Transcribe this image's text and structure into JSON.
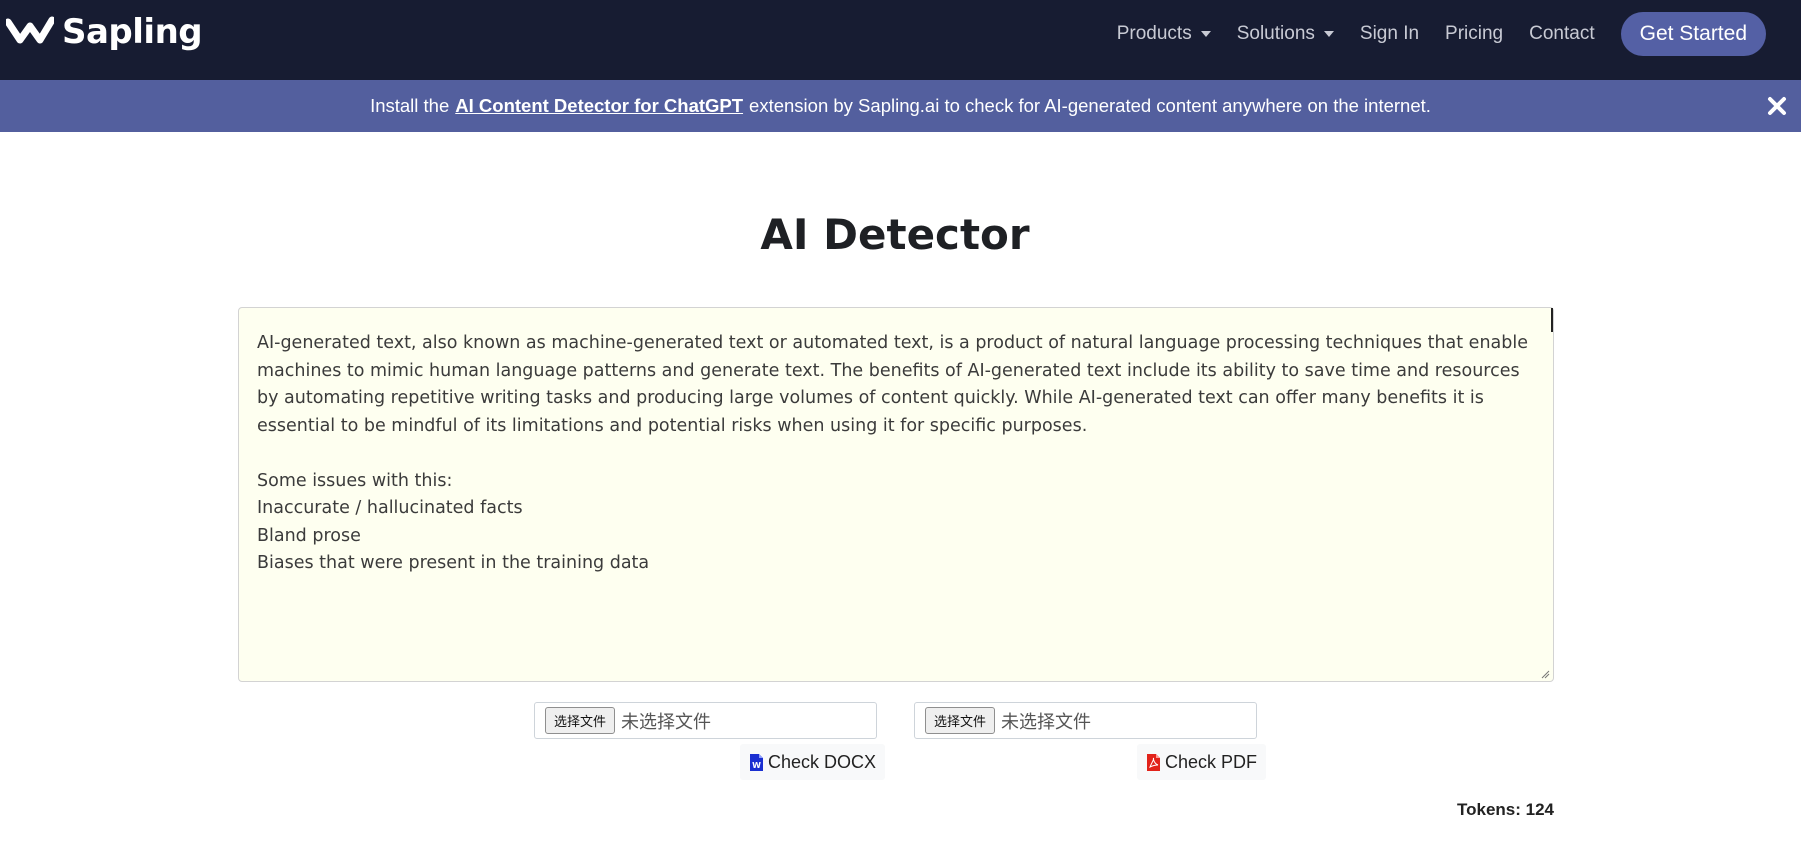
{
  "brand": {
    "name": "Sapling"
  },
  "nav": {
    "items": [
      {
        "label": "Products",
        "dropdown": true
      },
      {
        "label": "Solutions",
        "dropdown": true
      },
      {
        "label": "Sign In",
        "dropdown": false
      },
      {
        "label": "Pricing",
        "dropdown": false
      },
      {
        "label": "Contact",
        "dropdown": false
      }
    ],
    "cta_label": "Get Started"
  },
  "banner": {
    "prefix": "Install the",
    "link_text": "AI Content Detector for ChatGPT",
    "suffix": "extension by Sapling.ai to check for AI-generated content anywhere on the internet."
  },
  "page": {
    "title": "AI Detector",
    "editor_text": "AI-generated text, also known as machine-generated text or automated text, is a product of natural language processing techniques that enable machines to mimic human language patterns and generate text. The benefits of AI-generated text include its ability to save time and resources by automating repetitive writing tasks and producing large volumes of content quickly. While AI-generated text can offer many benefits it is essential to be mindful of its limitations and potential risks when using it for specific purposes.\n\nSome issues with this:\nInaccurate / hallucinated facts\nBland prose\nBiases that were present in the training data"
  },
  "uploads": {
    "choose_label": "选择文件",
    "no_file_label": "未选择文件",
    "check_docx": "Check DOCX",
    "check_pdf": "Check PDF"
  },
  "tokens": "Tokens: 124",
  "colors": {
    "navbar": "#171c32",
    "banner": "#535f9e",
    "cta": "#5460a5",
    "editor_bg": "#fefff0",
    "docx_icon": "#1a2fd1",
    "pdf_icon": "#e2231a"
  }
}
